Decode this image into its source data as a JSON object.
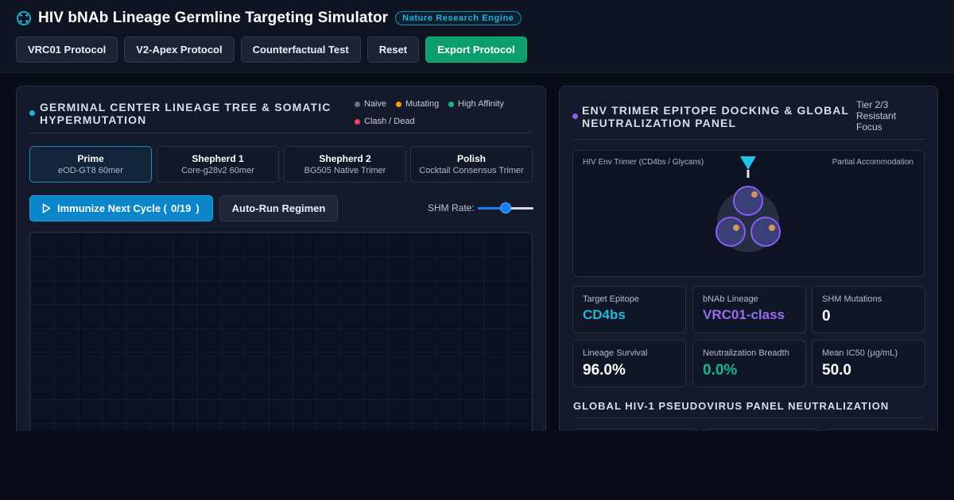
{
  "header": {
    "title": "HIV bNAb Lineage Germline Targeting Simulator",
    "badge": "Nature Research Engine",
    "icon": "virus-icon",
    "buttons": {
      "vrc01": "VRC01 Protocol",
      "v2apex": "V2-Apex Protocol",
      "counterfactual": "Counterfactual Test",
      "reset": "Reset",
      "export": "Export Protocol"
    }
  },
  "left_panel": {
    "title_line1": "GERMINAL CENTER LINEAGE TREE & SOMATIC",
    "title_line2": "HYPERMUTATION",
    "legend": [
      {
        "label": "Naive",
        "color": "#6b7280"
      },
      {
        "label": "Mutating",
        "color": "#f59e0b"
      },
      {
        "label": "High Affinity",
        "color": "#10b981"
      },
      {
        "label": "Clash / Dead",
        "color": "#f43f5e"
      }
    ],
    "stages": [
      {
        "name": "Prime",
        "sub": "eOD-GT8 60mer",
        "active": true
      },
      {
        "name": "Shepherd 1",
        "sub": "Core-g28v2 60mer",
        "active": false
      },
      {
        "name": "Shepherd 2",
        "sub": "BG505 Native Trimer",
        "active": false
      },
      {
        "name": "Polish",
        "sub": "Cocktail Consensus Trimer",
        "active": false
      }
    ],
    "immunize_prefix": "Immunize Next Cycle (",
    "immunize_count": "0/19",
    "immunize_suffix": ")",
    "auto_run": "Auto-Run Regimen",
    "shm_label": "SHM Rate:",
    "shm_rate_fraction": 0.5
  },
  "right_panel": {
    "title_line1": "ENV TRIMER EPITOPE DOCKING & GLOBAL",
    "title_line2": "NEUTRALIZATION PANEL",
    "tier_line1": "Tier 2/3",
    "tier_line2": "Resistant",
    "tier_line3": "Focus",
    "dock_left_label": "HIV Env Trimer (CD4bs / Glycans)",
    "dock_right_label": "Partial Accommodation",
    "stats": [
      {
        "label": "Target Epitope",
        "value": "CD4bs",
        "color": "#22b8d8"
      },
      {
        "label": "bNAb Lineage",
        "value": "VRC01-class",
        "color": "#9b6bf2"
      },
      {
        "label": "SHM Mutations",
        "value": "0",
        "color": "#ffffff"
      },
      {
        "label": "Lineage Survival",
        "value": "96.0%",
        "color": "#ffffff"
      },
      {
        "label": "Neutralization Breadth",
        "value": "0.0%",
        "color": "#14b88a"
      },
      {
        "label": "Mean IC50 (μg/mL)",
        "value": "50.0",
        "color": "#ffffff"
      }
    ],
    "panel_title": "GLOBAL HIV-1 PSEUDOVIRUS PANEL NEUTRALIZATION"
  },
  "colors": {
    "accent_cyan": "#22b4d8",
    "accent_purple": "#8b5cf6",
    "export_green": "#0d9e6e",
    "immunize_blue": "#0a86c9"
  }
}
